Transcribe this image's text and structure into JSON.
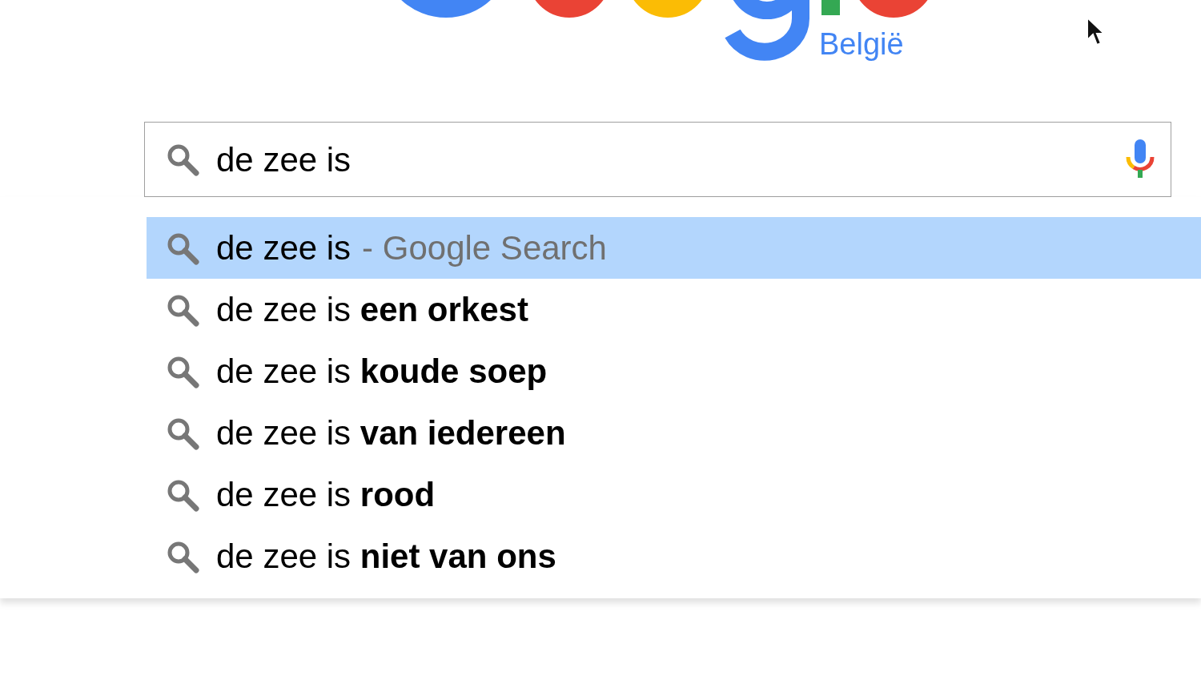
{
  "logo": {
    "region": "België"
  },
  "search": {
    "value": "de zee is"
  },
  "suggestions": [
    {
      "kind": "search",
      "text": "de zee is",
      "hint": "- Google Search",
      "selected": true
    },
    {
      "kind": "completion",
      "text": "de zee is **een orkest**",
      "selected": false
    },
    {
      "kind": "completion",
      "text": "de zee is **koude soep**",
      "selected": false
    },
    {
      "kind": "completion",
      "text": "de zee is **van iedereen**",
      "selected": false
    },
    {
      "kind": "completion",
      "text": "de zee is **rood**",
      "selected": false
    },
    {
      "kind": "completion",
      "text": "de zee is **niet van ons**",
      "selected": false
    }
  ]
}
